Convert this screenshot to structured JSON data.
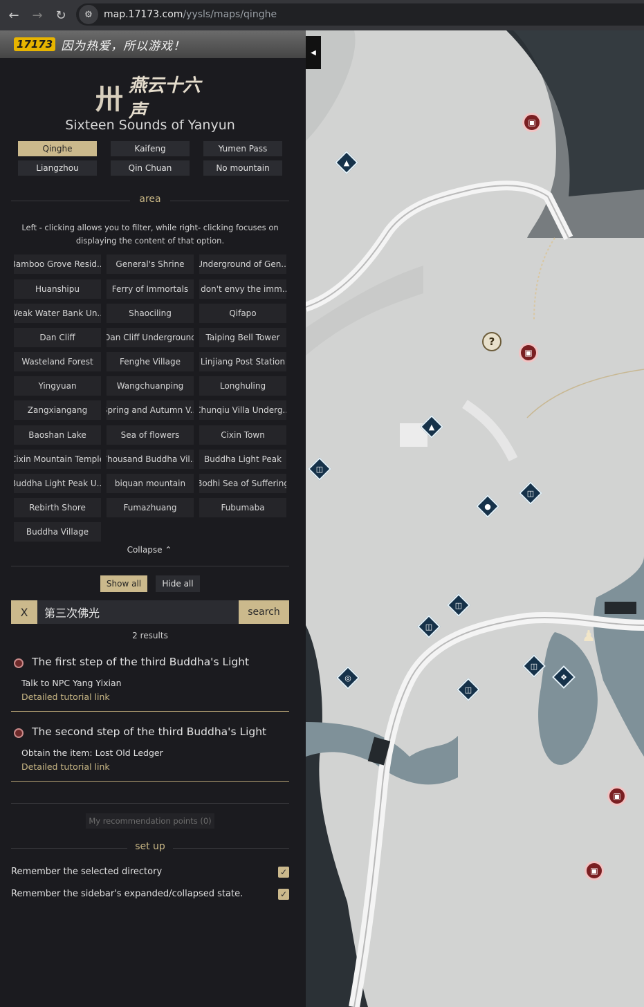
{
  "browser": {
    "url_domain": "map.17173.com",
    "url_path": "/yysls/maps/qinghe",
    "back_icon": "arrow-left-icon",
    "forward_icon": "arrow-right-icon",
    "reload_icon": "reload-icon",
    "site_info_icon": "site-settings-icon"
  },
  "banner": {
    "logo_text": "17173",
    "slogan": "因为热爱，所以游戏！"
  },
  "game": {
    "logo_mark": "卅",
    "logo_cn": "燕云十六声",
    "title": "Sixteen Sounds of Yanyun"
  },
  "map_tabs": [
    "Qinghe",
    "Kaifeng",
    "Yumen Pass",
    "Liangzhou",
    "Qin Chuan",
    "No mountain"
  ],
  "area": {
    "header": "area",
    "hint": "Left - clicking allows you to filter, while right- clicking focuses on displaying the content of that option.",
    "items": [
      "Bamboo Grove Resid...",
      "General's Shrine",
      "Underground of Gen...",
      "Huanshipu",
      "Ferry of Immortals",
      "I don't envy the imm...",
      "Weak Water Bank Un...",
      "Shaociling",
      "Qifapo",
      "Dan Cliff",
      "Dan Cliff Underground",
      "Taiping Bell Tower",
      "Wasteland Forest",
      "Fenghe Village",
      "Linjiang Post Station",
      "Yingyuan",
      "Wangchuanping",
      "Longhuling",
      "Zangxiangang",
      "Spring and Autumn V...",
      "Chunqiu Villa Underg...",
      "Baoshan Lake",
      "Sea of flowers",
      "Cixin Town",
      "Cixin Mountain Temple",
      "Thousand Buddha Vil...",
      "Buddha Light Peak",
      "Buddha Light Peak U...",
      "biquan mountain",
      "Bodhi Sea of Suffering",
      "Rebirth Shore",
      "Fumazhuang",
      "Fubumaba",
      "Buddha Village"
    ],
    "collapse_label": "Collapse ⌃"
  },
  "controls": {
    "show_all": "Show all",
    "hide_all": "Hide all"
  },
  "search": {
    "clear_label": "X",
    "value": "第三次佛光",
    "button_label": "search",
    "result_count": "2 results"
  },
  "results": [
    {
      "title": "The first step of the third Buddha's Light",
      "description": "Talk to NPC Yang Yixian",
      "link": "Detailed tutorial link"
    },
    {
      "title": "The second step of the third Buddha's Light",
      "description": "Obtain the item: Lost Old Ledger",
      "link": "Detailed tutorial link"
    }
  ],
  "recommendation": "My recommendation points (0)",
  "setup": {
    "header": "set up",
    "options": [
      {
        "label": "Remember the selected directory",
        "checked": true
      },
      {
        "label": "Remember the sidebar's expanded/collapsed state.",
        "checked": true
      }
    ]
  },
  "map": {
    "toggle_icon": "collapse-sidebar-icon",
    "quest_symbol": "?",
    "colors": {
      "accent_gold": "#cbb98c",
      "sidebar_bg": "#1b1b1f",
      "map_land": "#d3d4d3",
      "map_water": "#2b3136",
      "marker_red": "#7a1f22",
      "marker_blue": "#16324a"
    }
  }
}
